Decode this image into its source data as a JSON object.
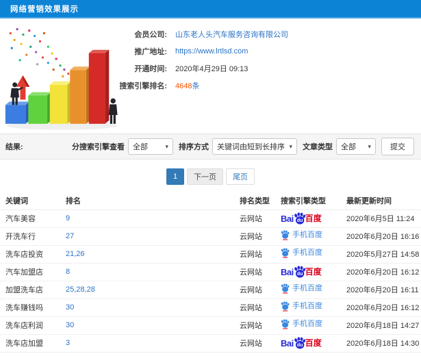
{
  "header": {
    "title": "网络营销效果展示"
  },
  "info": {
    "illustration": "3d-growth-bar-chart-with-businessmen",
    "fields": [
      {
        "label": "会员公司:",
        "value": "山东老人头汽车服务咨询有限公司",
        "type": "link"
      },
      {
        "label": "推广地址:",
        "value": "https://www.lrtlsd.com",
        "type": "link"
      },
      {
        "label": "开通时间:",
        "value": "2020年4月29日 09:13",
        "type": "text"
      },
      {
        "label": "搜索引擎排名:",
        "value": "4648",
        "suffix": "条",
        "type": "highlight"
      }
    ]
  },
  "filters": {
    "result_label": "结果:",
    "engine_filter_label": "分搜索引擎查看",
    "engine_filter_value": "全部",
    "sort_label": "排序方式",
    "sort_value": "关键词由短到长排序",
    "article_type_label": "文章类型",
    "article_type_value": "全部",
    "submit_label": "提交"
  },
  "pagination": {
    "current": "1",
    "next": "下一页",
    "last": "尾页"
  },
  "table": {
    "headers": [
      "关键词",
      "排名",
      "排名类型",
      "搜索引擎类型",
      "最新更新时间"
    ],
    "rows": [
      {
        "keyword": "汽车美容",
        "rank": "9",
        "rank_type": "云网站",
        "engine": "baidu-pc",
        "time": "2020年6月5日 11:24"
      },
      {
        "keyword": "开洗车行",
        "rank": "27",
        "rank_type": "云网站",
        "engine": "baidu-mobile",
        "time": "2020年6月20日 16:16"
      },
      {
        "keyword": "洗车店投资",
        "rank": "21,26",
        "rank_type": "云网站",
        "engine": "baidu-mobile",
        "time": "2020年5月27日 14:58"
      },
      {
        "keyword": "汽车加盟店",
        "rank": "8",
        "rank_type": "云网站",
        "engine": "baidu-pc",
        "time": "2020年6月20日 16:12"
      },
      {
        "keyword": "加盟洗车店",
        "rank": "25,28,28",
        "rank_type": "云网站",
        "engine": "baidu-mobile",
        "time": "2020年6月20日 16:11"
      },
      {
        "keyword": "洗车赚钱吗",
        "rank": "30",
        "rank_type": "云网站",
        "engine": "baidu-mobile",
        "time": "2020年6月20日 16:12"
      },
      {
        "keyword": "洗车店利润",
        "rank": "30",
        "rank_type": "云网站",
        "engine": "baidu-mobile",
        "time": "2020年6月18日 14:27"
      },
      {
        "keyword": "洗车店加盟",
        "rank": "3",
        "rank_type": "云网站",
        "engine": "baidu-pc",
        "time": "2020年6月18日 14:30"
      }
    ]
  },
  "logos": {
    "baidu_pc": {
      "bai": "Bai",
      "du": "du",
      "hanzi": "百度"
    },
    "baidu_mobile": {
      "label": "手机百度"
    }
  },
  "colors": {
    "header_blue": "#0d83d6",
    "link_blue": "#2a72c5",
    "highlight_orange": "#ff5500",
    "pagination_active": "#337ab7",
    "baidu_blue": "#2529d8",
    "baidu_red": "#d9001b",
    "mobile_blue": "#3a87e0"
  }
}
